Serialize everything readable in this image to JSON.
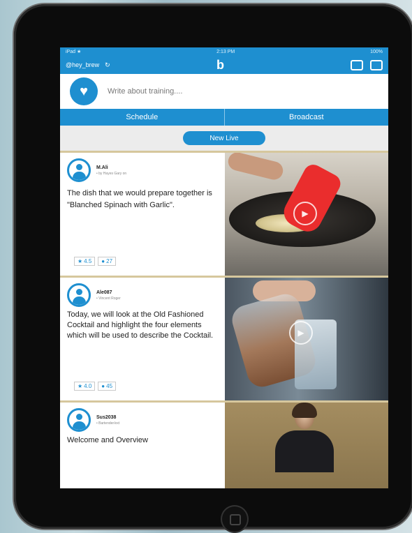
{
  "status_bar": {
    "left": "iPad ★",
    "center": "2:13 PM",
    "right": "100%"
  },
  "nav": {
    "username": "@hey_brew",
    "refresh_icon": "refresh-icon",
    "logo_glyph": "b"
  },
  "compose": {
    "placeholder": "Write about training...."
  },
  "tabs": [
    {
      "label": "Schedule"
    },
    {
      "label": "Broadcast"
    }
  ],
  "live_button": {
    "label": "New Live"
  },
  "posts": [
    {
      "user": "M.Ali",
      "sub": "• by Hayes Gary on",
      "text": "The dish that we would prepare together is \"Blanched Spinach with Garlic\".",
      "rating": "4.5",
      "comments": "27"
    },
    {
      "user": "Ale087",
      "sub": "• Vincent Roger",
      "text": "Today, we will look at the Old Fashioned Cocktail and highlight the four elements which will be used to describe the Cocktail.",
      "rating": "4.0",
      "comments": "45"
    },
    {
      "user": "Sus2038",
      "sub": "• Bartender/ext",
      "text": "Welcome and Overview",
      "rating": "",
      "comments": ""
    }
  ],
  "colors": {
    "brand_blue": "#1e8fd0",
    "device_black": "#0c0c0c"
  }
}
